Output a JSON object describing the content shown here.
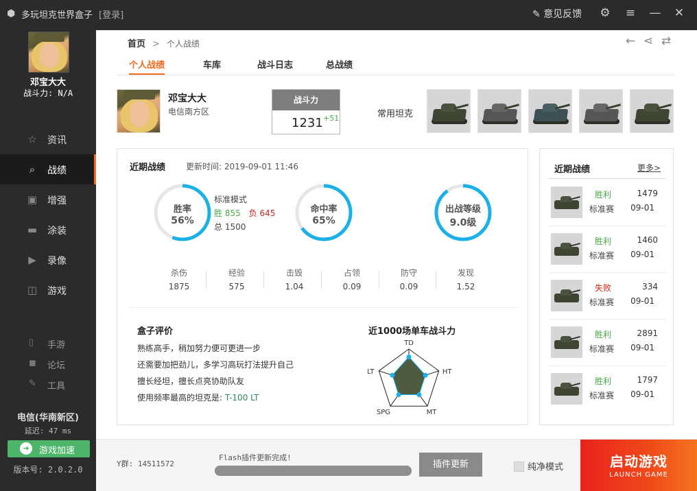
{
  "window": {
    "title": "多玩坦克世界盒子",
    "login": "[登录]",
    "feedback": "意见反馈",
    "icons": [
      "logo-icon",
      "edit-icon",
      "gear-icon",
      "menu-icon",
      "minimize-icon",
      "close-icon"
    ]
  },
  "sidebar": {
    "user_name": "邓宝大大",
    "user_power": "战斗力: N/A",
    "nav": [
      {
        "label": "资讯",
        "icon": "star-icon",
        "glyph": "☆"
      },
      {
        "label": "战绩",
        "icon": "search-icon",
        "glyph": "⌕"
      },
      {
        "label": "增强",
        "icon": "toolbox-icon",
        "glyph": "▣"
      },
      {
        "label": "涂装",
        "icon": "paint-roller-icon",
        "glyph": "▬"
      },
      {
        "label": "录像",
        "icon": "video-icon",
        "glyph": "▶"
      },
      {
        "label": "游戏",
        "icon": "gamepad-icon",
        "glyph": "◫"
      }
    ],
    "sub": [
      {
        "label": "手游",
        "icon": "phone-icon",
        "glyph": "▯"
      },
      {
        "label": "论坛",
        "icon": "chat-icon",
        "glyph": "◼"
      },
      {
        "label": "工具",
        "icon": "wrench-icon",
        "glyph": "✎"
      }
    ],
    "server": "电信(华南新区)",
    "latency": "延迟: 47 ms",
    "speed_button": "游戏加速",
    "version": "版本号: 2.0.2.0"
  },
  "main": {
    "breadcrumb": {
      "home": "首页",
      "separator": ">",
      "current": "个人战绩"
    },
    "tabs": [
      "个人战绩",
      "车库",
      "战斗日志",
      "总战绩"
    ],
    "profile": {
      "name": "邓宝大大",
      "server": "电信南方区"
    },
    "power": {
      "label": "战斗力",
      "value": "1231",
      "delta": "+51"
    },
    "usual_tanks_label": "常用坦克",
    "recent": {
      "title": "近期战绩",
      "update_time": "更新时间: 2019-09-01 11:46",
      "rings": [
        {
          "label": "胜率",
          "value": "56%",
          "fraction": 0.56
        },
        {
          "label": "命中率",
          "value": "65%",
          "fraction": 0.65
        },
        {
          "label": "出战等级",
          "value": "9.0级",
          "fraction": 0.9
        }
      ],
      "mode": "标准模式",
      "wins": "胜 855",
      "losses": "负 645",
      "total": "总 1500",
      "metrics": [
        {
          "label": "杀伤",
          "value": "1875"
        },
        {
          "label": "经验",
          "value": "575"
        },
        {
          "label": "击毁",
          "value": "1.04"
        },
        {
          "label": "占领",
          "value": "0.09"
        },
        {
          "label": "防守",
          "value": "0.09"
        },
        {
          "label": "发现",
          "value": "1.52"
        }
      ]
    },
    "evaluation": {
      "title": "盒子评价",
      "lines": [
        "熟练高手，稍加努力便可更进一步",
        "还需要加把劲儿，多学习高玩打法提升自己",
        "擅长经坦，擅长点亮协助队友"
      ],
      "fav_prefix": "使用频率最高的坦克是: ",
      "fav_tank": "T-100 LT"
    },
    "radar": {
      "title": "近1000场单车战斗力",
      "axes": [
        "TD",
        "HT",
        "MT",
        "SPG",
        "LT"
      ],
      "values": [
        0.75,
        0.55,
        0.55,
        0.55,
        0.55
      ]
    },
    "recent_list": {
      "title": "近期战绩",
      "more": "更多>",
      "rows": [
        {
          "result": "胜利",
          "outcome": "win",
          "mode": "标准赛",
          "value": "1479",
          "date": "09-01"
        },
        {
          "result": "胜利",
          "outcome": "win",
          "mode": "标准赛",
          "value": "1460",
          "date": "09-01"
        },
        {
          "result": "失败",
          "outcome": "lose",
          "mode": "标准赛",
          "value": "334",
          "date": "09-01"
        },
        {
          "result": "胜利",
          "outcome": "win",
          "mode": "标准赛",
          "value": "2891",
          "date": "09-01"
        },
        {
          "result": "胜利",
          "outcome": "win",
          "mode": "标准赛",
          "value": "1797",
          "date": "09-01"
        }
      ]
    }
  },
  "bottom": {
    "qq_group": "Y群: 14511572",
    "flash_message": "Flash插件更新完成!",
    "progress": 1.0,
    "plugin_button": "插件更新",
    "pure_mode": "纯净模式",
    "launch_cn": "启动游戏",
    "launch_en": "LAUNCH GAME"
  },
  "colors": {
    "accent": "#f26b1d",
    "ring": "#1ab0e8",
    "win": "#4aa84a",
    "lose": "#d0231a",
    "radar_fill": "#4f5b3e",
    "launch": "#e8231a",
    "speed": "#4db56a"
  }
}
